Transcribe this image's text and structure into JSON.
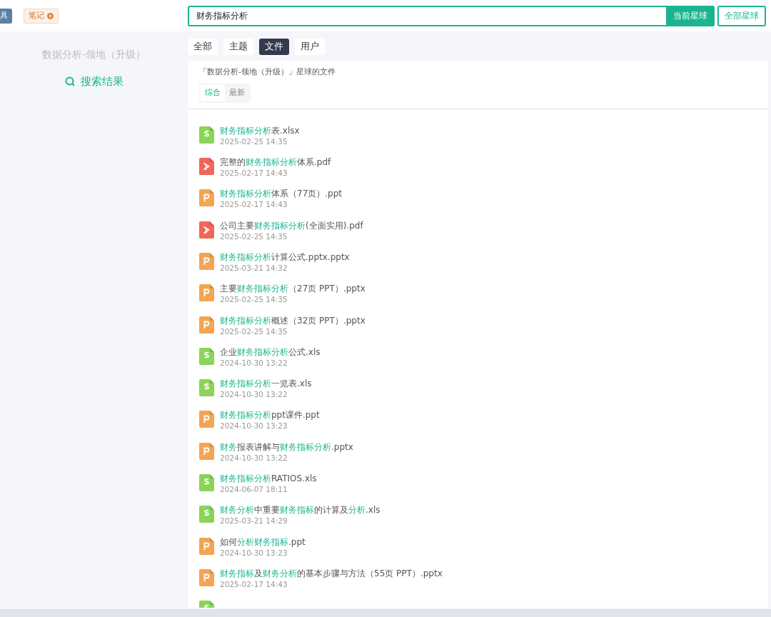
{
  "header": {
    "badges": [
      {
        "label": "具",
        "kind": "tool"
      },
      {
        "label": "笔记",
        "kind": "note"
      }
    ],
    "search": {
      "value": "财务指标分析"
    },
    "buttons": [
      {
        "label": "当前星球",
        "selected": true
      },
      {
        "label": "全部星球",
        "selected": false
      }
    ]
  },
  "sidebar": {
    "title": "数据分析-领地（升级）",
    "items": [
      {
        "label": "搜索结果",
        "selected": true
      }
    ]
  },
  "tabs": [
    {
      "label": "全部",
      "selected": false
    },
    {
      "label": "主题",
      "selected": false
    },
    {
      "label": "文件",
      "selected": true
    },
    {
      "label": "用户",
      "selected": false
    }
  ],
  "panel": {
    "heading": "「数据分析-领地（升级）」星球的文件",
    "sort_tabs": [
      {
        "label": "综合",
        "selected": true
      },
      {
        "label": "最新",
        "selected": false
      }
    ]
  },
  "files": [
    {
      "kind": "sheet",
      "name": [
        {
          "text": "财务指标分析",
          "highlight": true
        },
        {
          "text": "表.xlsx",
          "highlight": false
        }
      ],
      "time": "2025-02-25 14:35"
    },
    {
      "kind": "pdf",
      "name": [
        {
          "text": "完整的",
          "highlight": false
        },
        {
          "text": "财务指标分析",
          "highlight": true
        },
        {
          "text": "体系.pdf",
          "highlight": false
        }
      ],
      "time": "2025-02-17 14:43"
    },
    {
      "kind": "ppt",
      "name": [
        {
          "text": "财务指标分析",
          "highlight": true
        },
        {
          "text": "体系（77页）.ppt",
          "highlight": false
        }
      ],
      "time": "2025-02-17 14:43"
    },
    {
      "kind": "pdf",
      "name": [
        {
          "text": "公司主要",
          "highlight": false
        },
        {
          "text": "财务指标分析",
          "highlight": true
        },
        {
          "text": "(全面实用).pdf",
          "highlight": false
        }
      ],
      "time": "2025-02-25 14:35"
    },
    {
      "kind": "ppt",
      "name": [
        {
          "text": "财务指标分析",
          "highlight": true
        },
        {
          "text": "计算公式.pptx.pptx",
          "highlight": false
        }
      ],
      "time": "2025-03-21 14:32"
    },
    {
      "kind": "ppt",
      "name": [
        {
          "text": "主要",
          "highlight": false
        },
        {
          "text": "财务指标分析",
          "highlight": true
        },
        {
          "text": "（27页 PPT）.pptx",
          "highlight": false
        }
      ],
      "time": "2025-02-25 14:35"
    },
    {
      "kind": "ppt",
      "name": [
        {
          "text": "财务指标分析",
          "highlight": true
        },
        {
          "text": "概述（32页 PPT）.pptx",
          "highlight": false
        }
      ],
      "time": "2025-02-25 14:35"
    },
    {
      "kind": "sheet",
      "name": [
        {
          "text": "企业",
          "highlight": false
        },
        {
          "text": "财务指标分析",
          "highlight": true
        },
        {
          "text": "公式.xls",
          "highlight": false
        }
      ],
      "time": "2024-10-30 13:22"
    },
    {
      "kind": "sheet",
      "name": [
        {
          "text": "财务指标分析",
          "highlight": true
        },
        {
          "text": "一览表.xls",
          "highlight": false
        }
      ],
      "time": "2024-10-30 13:22"
    },
    {
      "kind": "ppt",
      "name": [
        {
          "text": "财务指标分析",
          "highlight": true
        },
        {
          "text": "ppt课件.ppt",
          "highlight": false
        }
      ],
      "time": "2024-10-30 13:23"
    },
    {
      "kind": "ppt",
      "name": [
        {
          "text": "财务",
          "highlight": true
        },
        {
          "text": "报表讲解与",
          "highlight": false
        },
        {
          "text": "财务指标分析",
          "highlight": true
        },
        {
          "text": ".pptx",
          "highlight": false
        }
      ],
      "time": "2024-10-30 13:22"
    },
    {
      "kind": "sheet",
      "name": [
        {
          "text": "财务指标分析",
          "highlight": true
        },
        {
          "text": "RATIOS.xls",
          "highlight": false
        }
      ],
      "time": "2024-06-07 18:11"
    },
    {
      "kind": "sheet",
      "name": [
        {
          "text": "财务分析",
          "highlight": true
        },
        {
          "text": "中重要",
          "highlight": false
        },
        {
          "text": "财务指标",
          "highlight": true
        },
        {
          "text": "的计算及",
          "highlight": false
        },
        {
          "text": "分析",
          "highlight": true
        },
        {
          "text": ".xls",
          "highlight": false
        }
      ],
      "time": "2025-03-21 14:29"
    },
    {
      "kind": "ppt",
      "name": [
        {
          "text": "如何",
          "highlight": false
        },
        {
          "text": "分析财务指标",
          "highlight": true
        },
        {
          "text": ".ppt",
          "highlight": false
        }
      ],
      "time": "2024-10-30 13:23"
    },
    {
      "kind": "ppt",
      "name": [
        {
          "text": "财务指标",
          "highlight": true
        },
        {
          "text": "及",
          "highlight": false
        },
        {
          "text": "财务分析",
          "highlight": true
        },
        {
          "text": "的基本步骤与方法（55页 PPT）.pptx",
          "highlight": false
        }
      ],
      "time": "2025-02-17 14:43"
    },
    {
      "kind": "sheet"
    }
  ]
}
